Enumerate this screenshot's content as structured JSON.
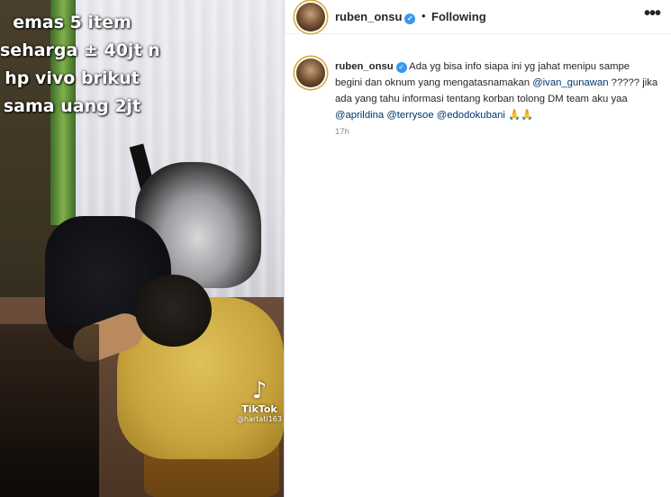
{
  "media": {
    "overlay_lines": [
      "emas 5 item",
      "seharga ± 40jt n",
      "hp vivo brikut",
      "sama uang 2jt"
    ],
    "watermark": {
      "logo_icon": "tiktok-note-icon",
      "logo_glyph": "♪",
      "name": "TikTok",
      "handle": "@hartati163"
    }
  },
  "header": {
    "username": "ruben_onsu",
    "verified_glyph": "✓",
    "separator": "•",
    "follow_status": "Following",
    "more_glyph": "•••"
  },
  "caption": {
    "username": "ruben_onsu",
    "verified_glyph": "✓",
    "text_part1": "Ada yg bisa info siapa ini yg jahat menipu sampe begini dan oknum yang mengatasnamakan",
    "mention1": "@ivan_gunawan",
    "text_part2": "????? jika ada yang tahu informasi tentang korban tolong DM team aku yaa",
    "mention2": "@aprildina",
    "mention3": "@terrysoe",
    "mention4": "@edodokubani",
    "emoji": "🙏🙏",
    "time": "17h"
  },
  "colors": {
    "verified": "#3897f0",
    "mention": "#00376b",
    "timestamp": "#8e8e8e",
    "story_ring": "#d6a537"
  }
}
